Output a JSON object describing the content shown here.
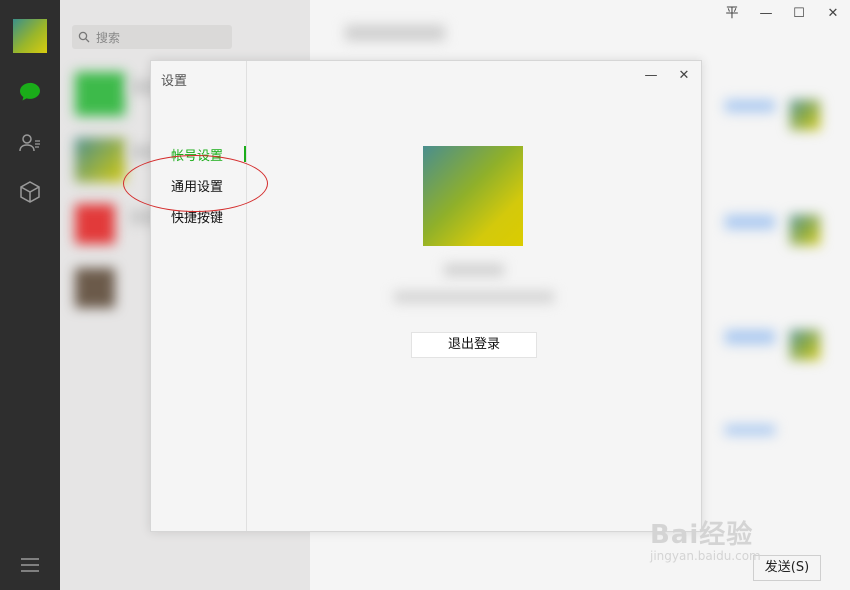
{
  "search": {
    "placeholder": "搜索"
  },
  "window_controls": {
    "pin": "平",
    "minimize": "—",
    "maximize": "☐",
    "close": "✕"
  },
  "dialog": {
    "title": "设置",
    "minimize": "—",
    "close": "✕",
    "nav": [
      {
        "label": "帐号设置",
        "active": true
      },
      {
        "label": "通用设置",
        "active": false
      },
      {
        "label": "快捷按键",
        "active": false
      }
    ],
    "logout_label": "退出登录"
  },
  "send_label": "发送(S)",
  "watermark": {
    "brand": "Bai经验",
    "url": "jingyan.baidu.com"
  },
  "colors": {
    "accent": "#1aad19",
    "annotation": "#d42c2c",
    "sidebar": "#2e2e2e"
  }
}
